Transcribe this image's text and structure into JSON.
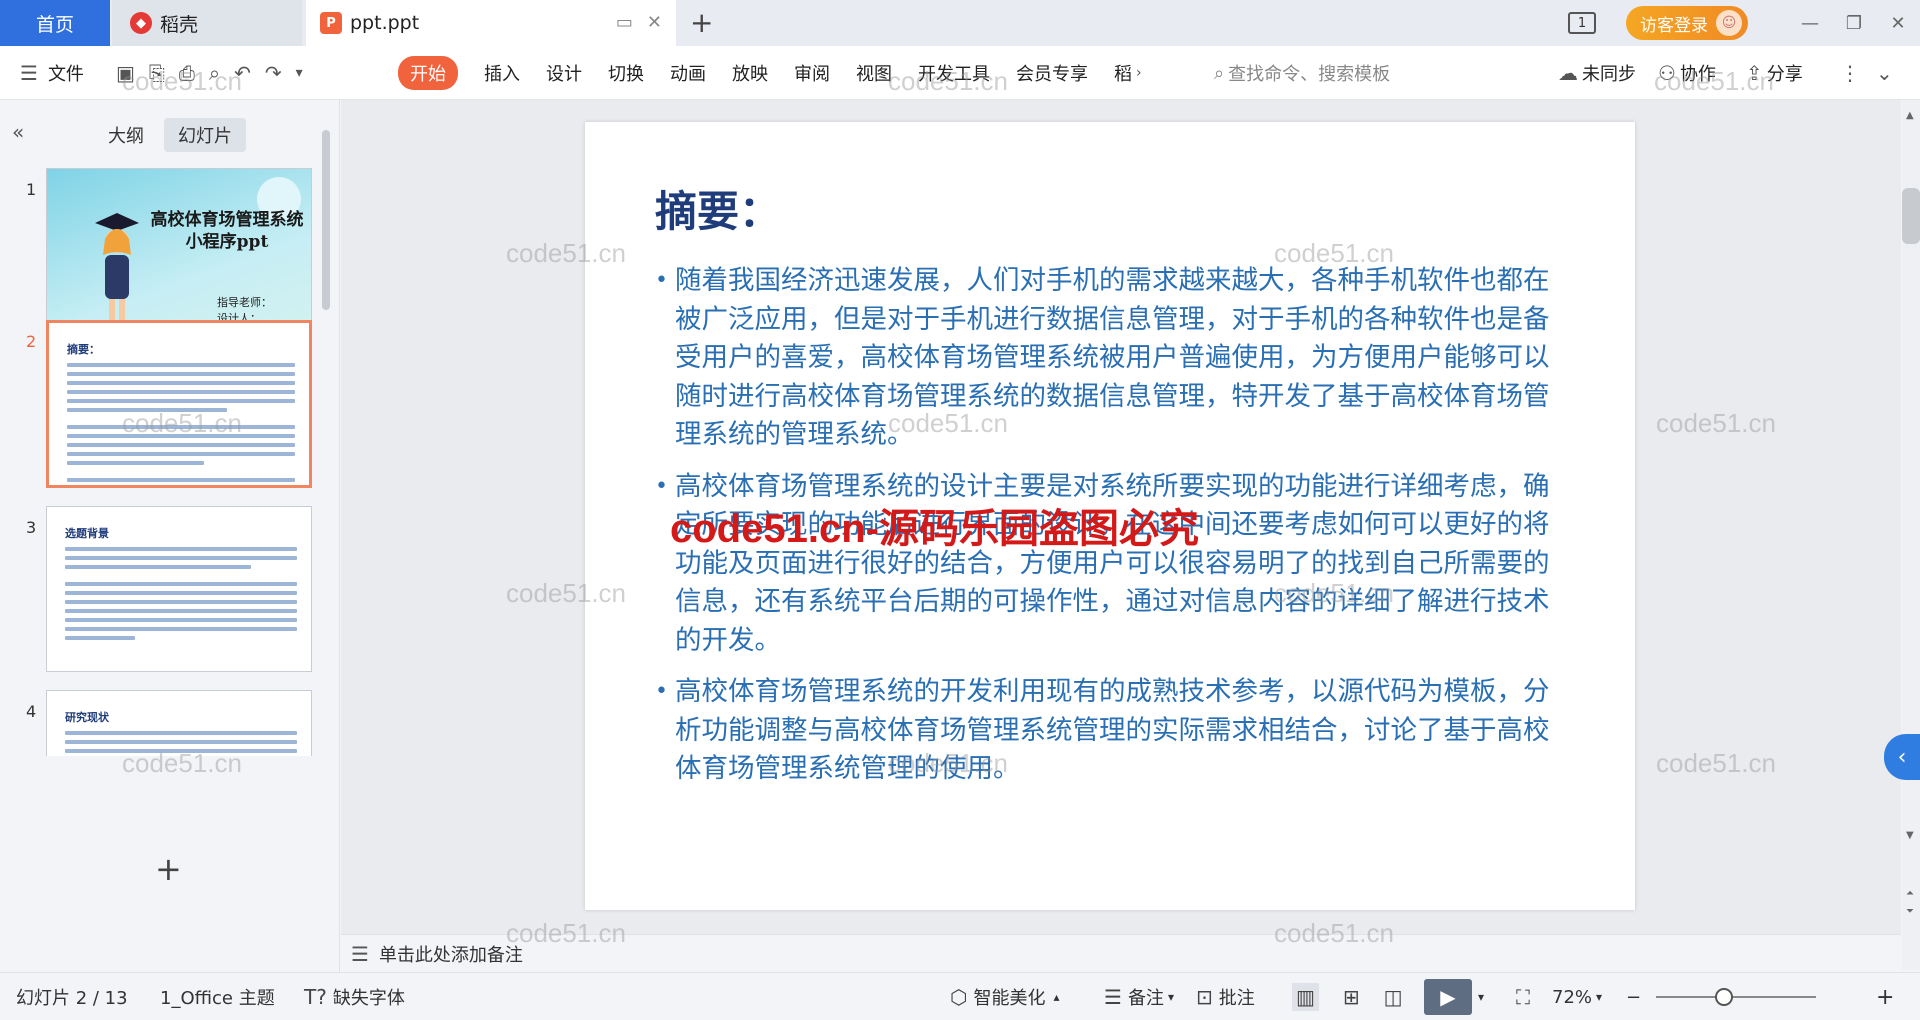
{
  "tabs": {
    "home": "首页",
    "docer": "稻壳",
    "doc": "ppt.ppt",
    "new_tab": "+"
  },
  "titlebar": {
    "slot_indicator": "1",
    "login_label": "访客登录"
  },
  "ribbon": {
    "file_label": "文件",
    "menu": [
      "开始",
      "插入",
      "设计",
      "切换",
      "动画",
      "放映",
      "审阅",
      "视图",
      "开发工具",
      "会员专享",
      "稻"
    ],
    "search_placeholder": "查找命令、搜索模板",
    "sync_label": "未同步",
    "collab_label": "协作",
    "share_label": "分享"
  },
  "left_panel": {
    "outline_tab": "大纲",
    "slides_tab": "幻灯片",
    "slides": [
      {
        "num": "1",
        "title": "高校体育场管理系统小程序ppt",
        "teacher": "指导老师：",
        "designer": "设计人："
      },
      {
        "num": "2",
        "title": "摘要："
      },
      {
        "num": "3",
        "title": "选题背景"
      },
      {
        "num": "4",
        "title": "研究现状"
      }
    ],
    "add_label": "+"
  },
  "slide": {
    "title": "摘要：",
    "bullets": [
      "随着我国经济迅速发展，人们对手机的需求越来越大，各种手机软件也都在被广泛应用，但是对于手机进行数据信息管理，对于手机的各种软件也是备受用户的喜爱，高校体育场管理系统被用户普遍使用，为方便用户能够可以随时进行高校体育场管理系统的数据信息管理，特开发了基于高校体育场管理系统的管理系统。",
      "高校体育场管理系统的设计主要是对系统所要实现的功能进行详细考虑，确定所要实现的功能后进行界面的设计，在这中间还要考虑如何可以更好的将功能及页面进行很好的结合，方便用户可以很容易明了的找到自己所需要的信息，还有系统平台后期的可操作性，通过对信息内容的详细了解进行技术的开发。",
      "高校体育场管理系统的开发利用现有的成熟技术参考，以源代码为模板，分析功能调整与高校体育场管理系统管理的实际需求相结合，讨论了基于高校体育场管理系统管理的使用。"
    ]
  },
  "notes_placeholder": "单击此处添加备注",
  "watermark": "code51.cn",
  "watermark_red": "code51.cn-源码乐园盗图必究",
  "status": {
    "slide_counter": "幻灯片 2 / 13",
    "theme": "1_Office 主题",
    "missing_font": "缺失字体",
    "beautify": "智能美化",
    "notes": "备注",
    "comment": "批注",
    "zoom": "72%"
  },
  "colors": {
    "accent": "#f0633d",
    "home_tab": "#2f6fde",
    "slide_title": "#1f3d7a",
    "slide_text": "#2a6fb3",
    "login": "#f5a623"
  }
}
